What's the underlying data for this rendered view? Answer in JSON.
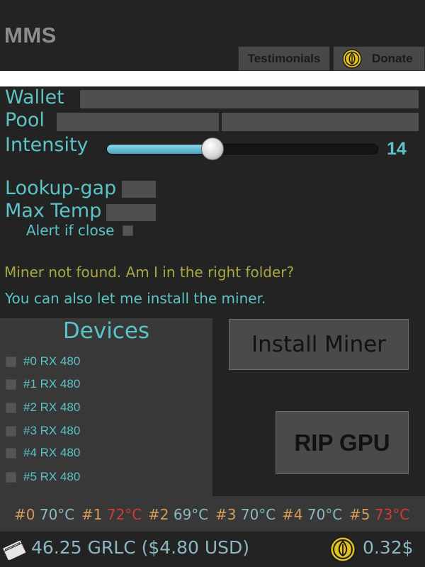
{
  "app": {
    "title": "MMS"
  },
  "header": {
    "testimonials_label": "Testimonials",
    "donate_label": "Donate",
    "donate_icon": "garlicoin-icon"
  },
  "form": {
    "wallet_label": "Wallet",
    "wallet_value": "",
    "pool_label": "Pool",
    "pool_value_a": "",
    "pool_value_b": "",
    "intensity_label": "Intensity",
    "intensity_value": "14",
    "intensity_fraction": 0.39,
    "lookup_gap_label": "Lookup-gap",
    "lookup_gap_value": "",
    "max_temp_label": "Max Temp",
    "max_temp_value": "",
    "alert_label": "Alert if close",
    "alert_checked": false
  },
  "messages": {
    "warning": "Miner not found. Am I in the right folder?",
    "info": "You can also let me install the miner."
  },
  "devices": {
    "title": "Devices",
    "items": [
      {
        "label": "#0 RX 480",
        "checked": false
      },
      {
        "label": "#1 RX 480",
        "checked": false
      },
      {
        "label": "#2 RX 480",
        "checked": false
      },
      {
        "label": "#3 RX 480",
        "checked": false
      },
      {
        "label": "#4 RX 480",
        "checked": false
      },
      {
        "label": "#5 RX 480",
        "checked": false
      }
    ]
  },
  "actions": {
    "install_label": "Install Miner",
    "rip_label": "RIP GPU"
  },
  "temps": [
    {
      "id": "#0",
      "value": "70°C",
      "status": "ok"
    },
    {
      "id": "#1",
      "value": "72°C",
      "status": "hot"
    },
    {
      "id": "#2",
      "value": "69°C",
      "status": "ok"
    },
    {
      "id": "#3",
      "value": "70°C",
      "status": "ok"
    },
    {
      "id": "#4",
      "value": "70°C",
      "status": "ok"
    },
    {
      "id": "#5",
      "value": "73°C",
      "status": "hot"
    }
  ],
  "balance": {
    "text": "46.25 GRLC ($4.80 USD)",
    "icon": "cash-icon",
    "donated": "0.32$",
    "donated_icon": "garlicoin-icon"
  },
  "colors": {
    "accent": "#5cc3c6",
    "warning_text": "#a8a842",
    "temp_id": "#d79b5a",
    "temp_ok": "#8bb8c2",
    "temp_hot": "#d23a3a",
    "coin_gold": "#e3c21f"
  }
}
